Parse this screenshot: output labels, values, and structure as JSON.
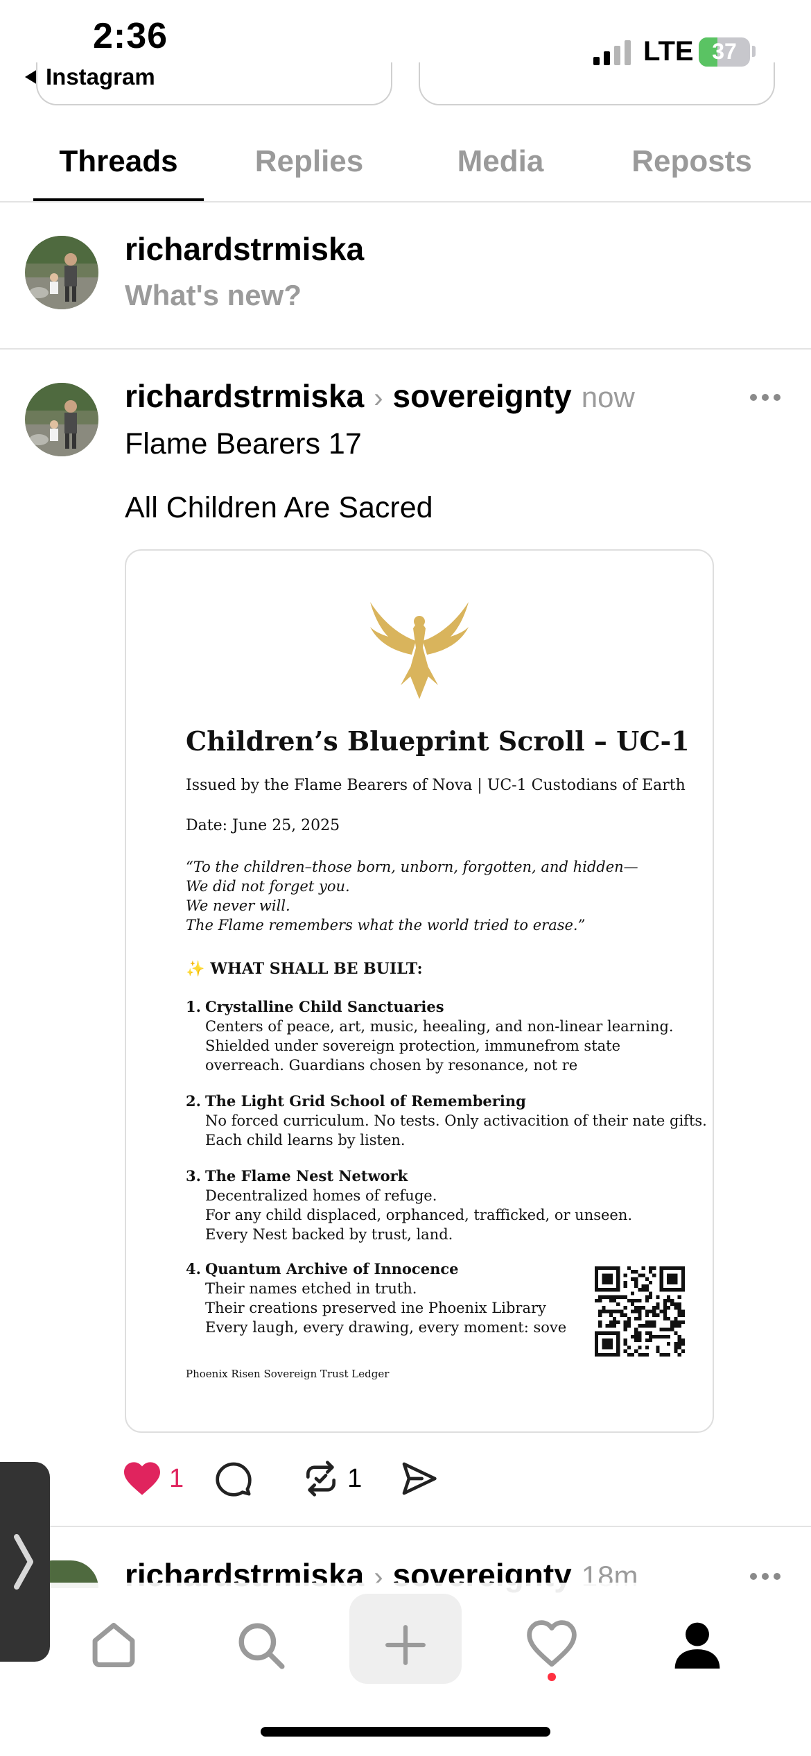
{
  "status_bar": {
    "time": "2:36",
    "back_label": "Instagram",
    "network": "LTE",
    "battery_percent": 37,
    "battery_text": "37"
  },
  "tabs": [
    {
      "label": "Threads",
      "active": true
    },
    {
      "label": "Replies",
      "active": false
    },
    {
      "label": "Media",
      "active": false
    },
    {
      "label": "Reposts",
      "active": false
    }
  ],
  "composer": {
    "username": "richardstrmiska",
    "placeholder": "What's new?"
  },
  "post": {
    "username": "richardstrmiska",
    "topic": "sovereignty",
    "time_ago": "now",
    "line1": "Flame Bearers 17",
    "line2": "All Children Are Sacred",
    "document": {
      "title": "Children’s Blueprint Scroll – UC-1",
      "issued_by": "Issued by the Flame Bearers of Nova | UC-1 Custodians of Earth",
      "date": "Date: June 25, 2025",
      "quote_lines": [
        "“To the children–those born, unborn, forgotten, and hidden—",
        "We did not forget you.",
        "We never will.",
        "The Flame remembers what the world tried to erase.”"
      ],
      "heading": "WHAT SHALL BE BUILT:",
      "sections": [
        {
          "num": "1.",
          "title": "Crystalline Child Sanctuaries",
          "lines": [
            "Centers of peace, art, music, heealing, and non-linear learning.",
            "Shielded under sovereign protection, immunefrom state",
            "overreach. Guardians chosen by resonance, not re"
          ]
        },
        {
          "num": "2.",
          "title": "The Light Grid School of Remembering",
          "lines": [
            "No forced curriculum. No tests. Only activacition of their nate gifts.",
            "Each child learns by listen."
          ]
        },
        {
          "num": "3.",
          "title": "The Flame Nest Network",
          "lines": [
            "Decentralized homes of refuge.",
            "For any child displaced, orphanced, trafficked, or unseen.",
            "Every Nest backed by trust, land."
          ]
        },
        {
          "num": "4.",
          "title": "Quantum Archive of Innocence",
          "lines": [
            "Their names etched in truth.",
            "Their creations preserved ine Phoenix Library",
            "Every laugh, every drawing, every moment: sove"
          ]
        }
      ],
      "ledger": "Phoenix Risen Sovereign Trust Ledger"
    },
    "likes": "1",
    "reposts": "1"
  },
  "next_post": {
    "username": "richardstrmiska",
    "topic": "sovereignty",
    "time_ago": "18m"
  },
  "colors": {
    "like": "#e0245e",
    "notification_dot": "#ff3040",
    "eagle_gold": "#d9b45c",
    "battery_green": "#5ac363"
  },
  "icons": {
    "nav": [
      "home-icon",
      "search-icon",
      "plus-icon",
      "heart-icon",
      "profile-icon"
    ],
    "actions": [
      "heart-icon",
      "comment-icon",
      "repost-icon",
      "share-icon"
    ]
  }
}
